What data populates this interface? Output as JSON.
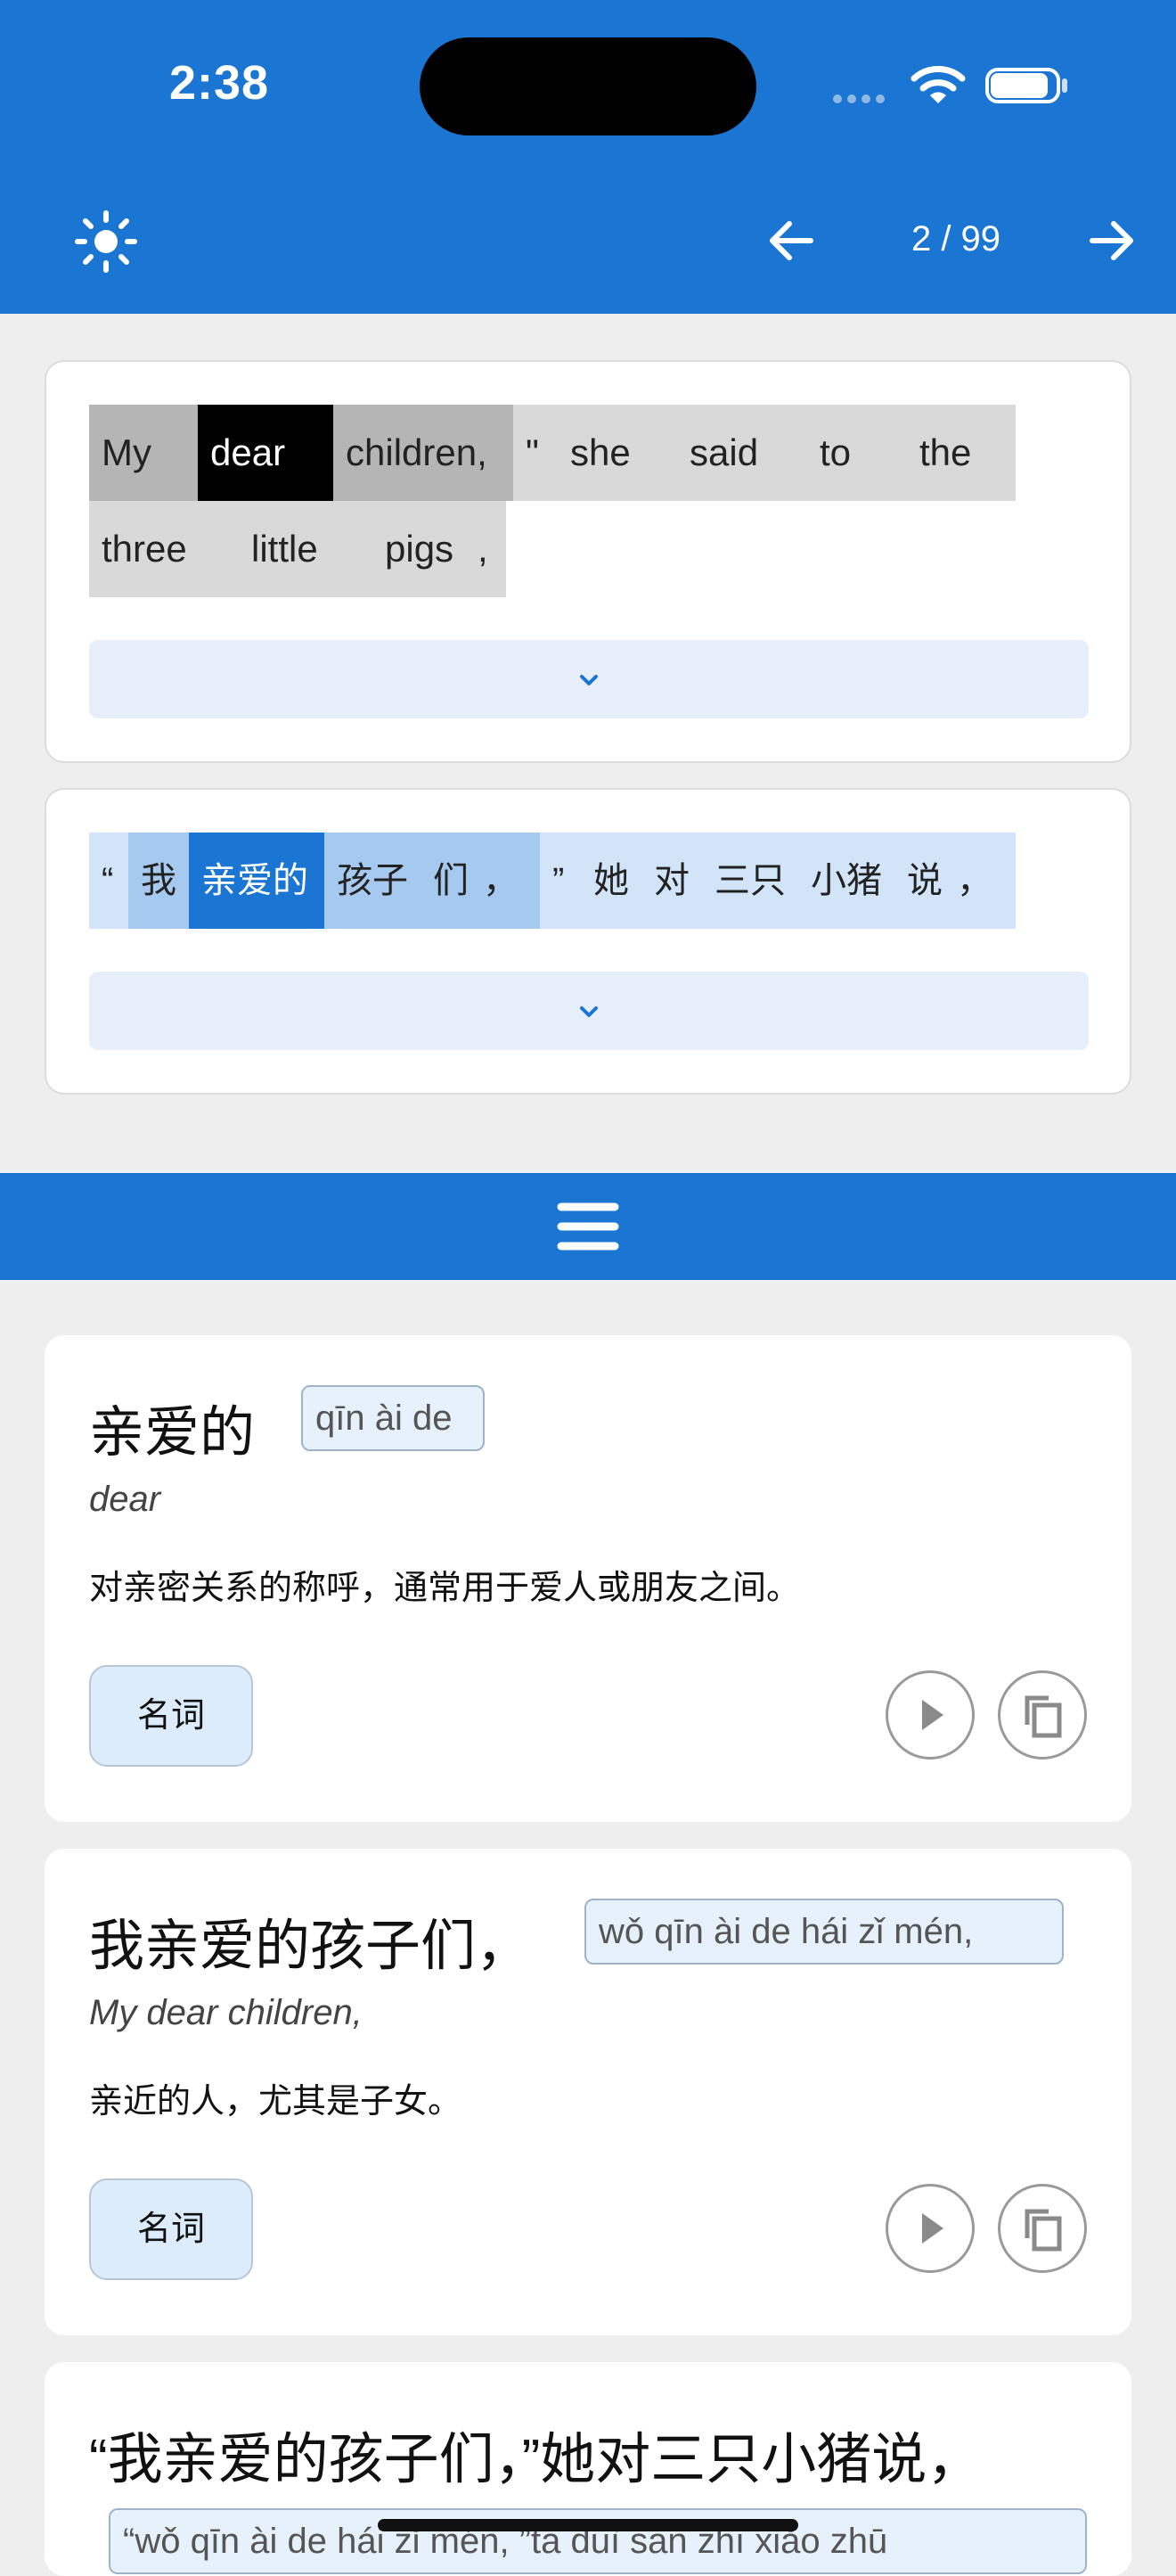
{
  "status_bar": {
    "time": "2:38"
  },
  "nav": {
    "page_indicator": "2 / 99"
  },
  "english_sentence": {
    "tokens": [
      "My",
      "dear",
      "children,",
      "\"",
      "she",
      "said",
      "to",
      "the",
      "three",
      "little",
      "pigs",
      ","
    ],
    "selected": "dear"
  },
  "chinese_sentence": {
    "tokens": [
      "“",
      "我",
      "亲爱的",
      "孩子",
      "们",
      "，",
      "”",
      "她",
      "对",
      "三只",
      "小猪",
      "说",
      "，"
    ],
    "selected": "亲爱的"
  },
  "entries": [
    {
      "headword": "亲爱的",
      "pinyin": "qīn ài de",
      "gloss": "dear",
      "definition": "对亲密关系的称呼，通常用于爱人或朋友之间。",
      "pos": "名词"
    },
    {
      "headword": "我亲爱的孩子们，",
      "pinyin": "wǒ qīn ài de hái zǐ mén,",
      "gloss": "My dear children,",
      "definition": "亲近的人，尤其是子女。",
      "pos": "名词"
    },
    {
      "headword": "“我亲爱的孩子们，”她对三只小猪说，",
      "pinyin": "“wǒ qīn ài de hái zǐ mén, ”tā duì sān zhī xiǎo zhū"
    }
  ],
  "colors": {
    "primary": "#1a76d2",
    "selected_en": "#000000",
    "selected_zh": "#1a76d2"
  }
}
